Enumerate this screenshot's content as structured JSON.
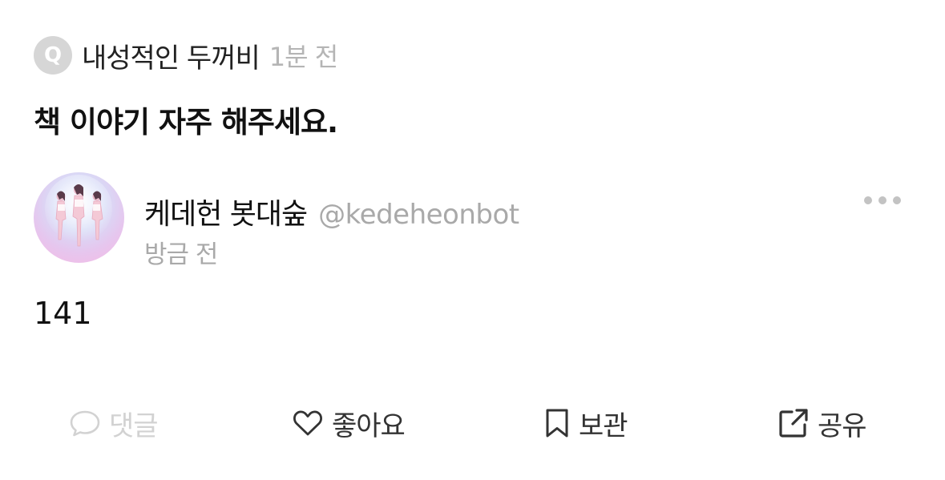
{
  "question": {
    "badge": "Q",
    "asker": "내성적인 두꺼비",
    "time": "1분 전",
    "text": "책 이야기 자주 해주세요."
  },
  "answer": {
    "author_name": "케데헌 봇대숲",
    "author_handle": "@kedeheonbot",
    "time": "방금 전",
    "text": "141"
  },
  "actions": {
    "comment": "댓글",
    "like": "좋아요",
    "save": "보관",
    "share": "공유"
  },
  "icons": {
    "comment": "speech-bubble-icon",
    "like": "heart-icon",
    "save": "bookmark-icon",
    "share": "share-out-icon",
    "more": "more-dots-icon"
  },
  "colors": {
    "text": "#111111",
    "muted": "#a9a9a9",
    "disabled": "#d2d2d2",
    "badge": "#d6d6d6"
  }
}
